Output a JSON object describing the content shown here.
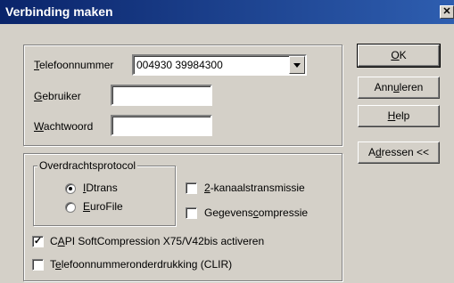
{
  "window": {
    "title": "Verbinding maken",
    "close": "✕"
  },
  "connection": {
    "phone": {
      "label_first": "T",
      "label_rest": "elefoonnummer",
      "value": "004930 39984300"
    },
    "user": {
      "label_first": "G",
      "label_rest": "ebruiker",
      "value": ""
    },
    "password": {
      "label_first": "W",
      "label_rest": "achtwoord",
      "value": ""
    }
  },
  "protocol": {
    "legend": "Overdrachtsprotocol",
    "idtrans": {
      "first": "I",
      "rest": "Dtrans",
      "selected": true
    },
    "eurofile": {
      "first": "E",
      "rest": "uroFile",
      "selected": false
    },
    "dual": {
      "first": "2",
      "rest": "-kanaalstransmissie",
      "checked": false
    },
    "compress": {
      "before": "Gegevens",
      "ul": "c",
      "after": "ompressie",
      "checked": false
    }
  },
  "options": {
    "capi": {
      "before": "C",
      "ul": "A",
      "after": "PI SoftCompression X75/V42bis activeren",
      "checked": true
    },
    "clir": {
      "before": "T",
      "ul": "e",
      "after": "lefoonnummeronderdrukking (CLIR)",
      "checked": false
    }
  },
  "buttons": {
    "ok": {
      "ul": "O",
      "after": "K"
    },
    "cancel": {
      "before": "Ann",
      "ul": "u",
      "after": "leren"
    },
    "help": {
      "ul": "H",
      "after": "elp"
    },
    "addresses": {
      "before": "A",
      "ul": "d",
      "after": "ressen <<"
    }
  },
  "check_mark": "✓"
}
